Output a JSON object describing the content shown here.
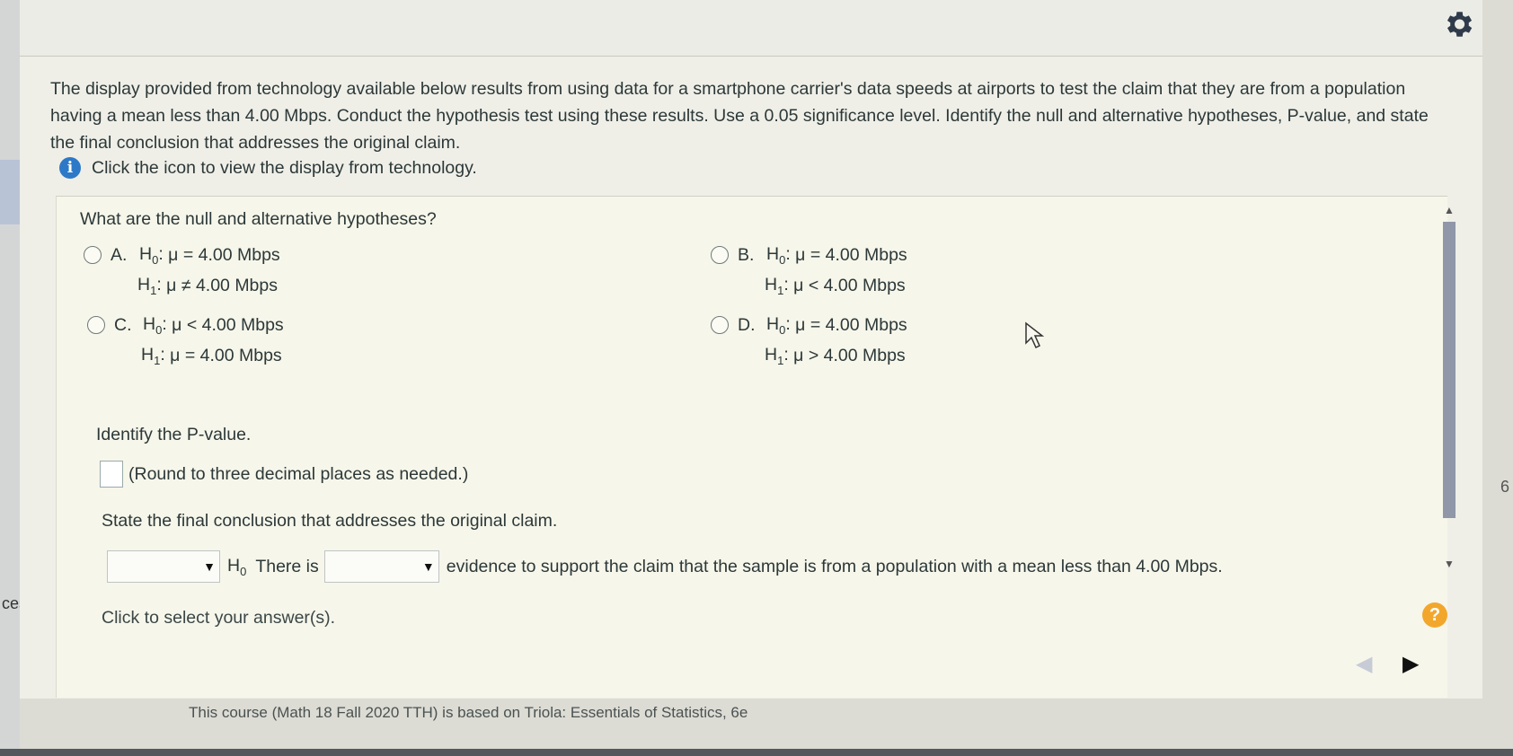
{
  "intro": {
    "text": "The display provided from technology available below results from using data for a smartphone carrier's data speeds at airports to test the claim that they are from a population having a mean less than 4.00 Mbps. Conduct the hypothesis test using these results. Use a 0.05 significance level. Identify the null and alternative hypotheses, P-value, and state the final conclusion that addresses the original claim.",
    "info_text": "Click the icon to view the display from technology."
  },
  "question": {
    "title": "What are the null and alternative hypotheses?",
    "options": [
      {
        "letter": "A.",
        "h0": "μ = 4.00 Mbps",
        "h1": "μ ≠ 4.00 Mbps"
      },
      {
        "letter": "B.",
        "h0": "μ = 4.00 Mbps",
        "h1": "μ < 4.00 Mbps"
      },
      {
        "letter": "C.",
        "h0": "μ < 4.00 Mbps",
        "h1": "μ = 4.00 Mbps"
      },
      {
        "letter": "D.",
        "h0": "μ = 4.00 Mbps",
        "h1": "μ > 4.00 Mbps"
      }
    ],
    "h0_label": "H",
    "h0_sub": "0",
    "h1_label": "H",
    "h1_sub": "1"
  },
  "pvalue": {
    "label": "Identify the P-value.",
    "hint": "(Round to three decimal places as needed.)"
  },
  "conclusion": {
    "label": "State the final conclusion that addresses the original claim.",
    "h0": "H",
    "h0_sub": "0",
    "there_is": "There is",
    "tail": "evidence to support the claim that the sample is from a population with a mean less than 4.00 Mbps."
  },
  "footer": {
    "click_hint": "Click to select your answer(s).",
    "help": "?",
    "course": "This course (Math 18 Fall 2020 TTH) is based on Triola: Essentials of Statistics, 6e"
  },
  "side": {
    "left_text": "ces",
    "right_text": "6"
  },
  "colors": {
    "info_icon": "#2d79c7",
    "help_button": "#f2a72c",
    "scroll_thumb": "#8f97a8"
  }
}
